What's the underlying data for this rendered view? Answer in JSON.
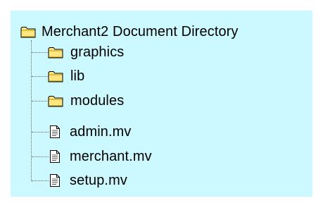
{
  "tree": {
    "root": {
      "label": "Merchant2 Document Directory",
      "icon": "folder-icon"
    },
    "children": [
      {
        "label": "graphics",
        "icon": "folder-icon"
      },
      {
        "label": "lib",
        "icon": "folder-icon"
      },
      {
        "label": "modules",
        "icon": "folder-icon"
      },
      {
        "label": "admin.mv",
        "icon": "file-icon"
      },
      {
        "label": "merchant.mv",
        "icon": "file-icon"
      },
      {
        "label": "setup.mv",
        "icon": "file-icon"
      }
    ]
  },
  "colors": {
    "panel_background": "#ccf8ff",
    "folder_fill": "#ffe680",
    "folder_dark": "#b8960a",
    "file_fill": "#ffffff",
    "connector": "#6a6a6a"
  }
}
